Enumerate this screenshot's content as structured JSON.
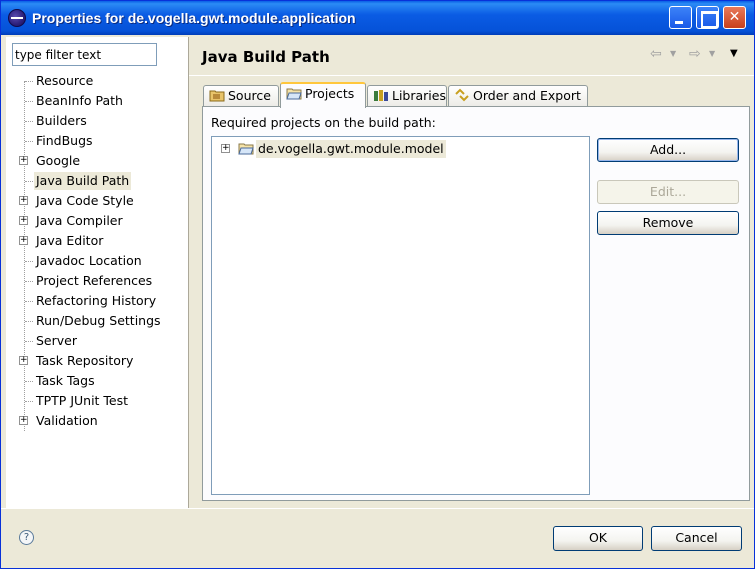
{
  "window": {
    "title": "Properties for de.vogella.gwt.module.application",
    "icon": "eclipse-icon"
  },
  "sidebar": {
    "filter_placeholder": "type filter text",
    "filter_value": "type filter text",
    "items": [
      {
        "label": "Resource",
        "expandable": false
      },
      {
        "label": "BeanInfo Path",
        "expandable": false
      },
      {
        "label": "Builders",
        "expandable": false
      },
      {
        "label": "FindBugs",
        "expandable": false
      },
      {
        "label": "Google",
        "expandable": true
      },
      {
        "label": "Java Build Path",
        "expandable": false,
        "selected": true
      },
      {
        "label": "Java Code Style",
        "expandable": true
      },
      {
        "label": "Java Compiler",
        "expandable": true
      },
      {
        "label": "Java Editor",
        "expandable": true
      },
      {
        "label": "Javadoc Location",
        "expandable": false
      },
      {
        "label": "Project References",
        "expandable": false
      },
      {
        "label": "Refactoring History",
        "expandable": false
      },
      {
        "label": "Run/Debug Settings",
        "expandable": false
      },
      {
        "label": "Server",
        "expandable": false
      },
      {
        "label": "Task Repository",
        "expandable": true
      },
      {
        "label": "Task Tags",
        "expandable": false
      },
      {
        "label": "TPTP JUnit Test",
        "expandable": false
      },
      {
        "label": "Validation",
        "expandable": true
      }
    ]
  },
  "main": {
    "title": "Java Build Path",
    "tabs": [
      {
        "label": "Source",
        "icon": "source-folder-icon"
      },
      {
        "label": "Projects",
        "icon": "project-folder-icon",
        "active": true
      },
      {
        "label": "Libraries",
        "icon": "libraries-icon"
      },
      {
        "label": "Order and Export",
        "icon": "order-export-icon"
      }
    ],
    "panel_label": "Required projects on the build path:",
    "projects": [
      {
        "label": "de.vogella.gwt.module.model"
      }
    ],
    "buttons": {
      "add": "Add...",
      "edit": "Edit...",
      "remove": "Remove"
    }
  },
  "footer": {
    "ok": "OK",
    "cancel": "Cancel"
  },
  "colors": {
    "titlebar": "#0552D8",
    "dialog_bg": "#ECE9D8",
    "active_tab_accent": "#FFC73C"
  }
}
